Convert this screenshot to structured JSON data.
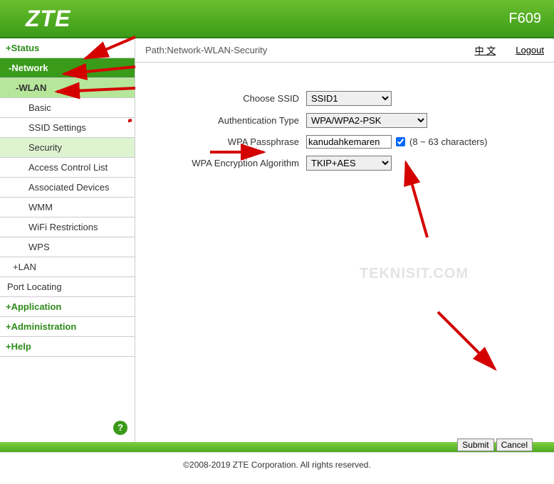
{
  "header": {
    "logo": "ZTE",
    "model": "F609"
  },
  "pathbar": {
    "path": "Path:Network-WLAN-Security",
    "lang": "中 文",
    "logout": "Logout"
  },
  "sidebar": {
    "status": "Status",
    "network": "Network",
    "wlan": "WLAN",
    "wlan_items": {
      "basic": "Basic",
      "ssid": "SSID Settings",
      "security": "Security",
      "acl": "Access Control List",
      "assoc": "Associated Devices",
      "wmm": "WMM",
      "wifir": "WiFi Restrictions",
      "wps": "WPS"
    },
    "lan": "LAN",
    "port": "Port Locating",
    "application": "Application",
    "administration": "Administration",
    "help": "Help"
  },
  "form": {
    "choose_ssid_label": "Choose SSID",
    "choose_ssid_value": "SSID1",
    "auth_label": "Authentication Type",
    "auth_value": "WPA/WPA2-PSK",
    "pass_label": "WPA Passphrase",
    "pass_value": "kanudahkemaren",
    "pass_hint": "(8 ~ 63 characters)",
    "enc_label": "WPA Encryption Algorithm",
    "enc_value": "TKIP+AES"
  },
  "buttons": {
    "submit": "Submit",
    "cancel": "Cancel"
  },
  "watermark": "TEKNISIT.COM",
  "footer": "©2008-2019 ZTE Corporation. All rights reserved."
}
